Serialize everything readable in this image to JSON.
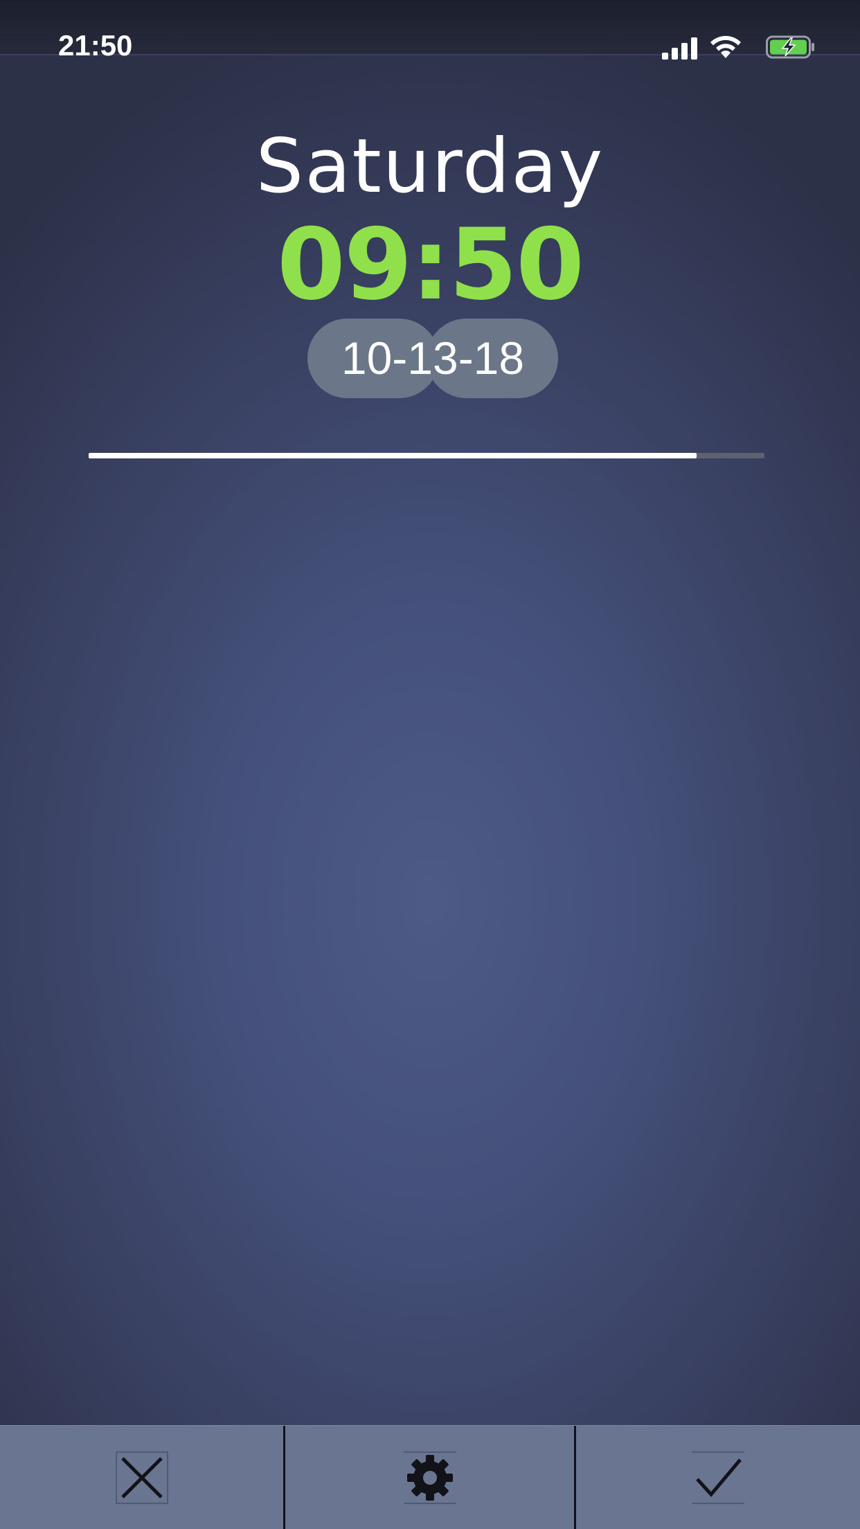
{
  "status_bar": {
    "time": "21:50",
    "icons": [
      "cellular-signal-icon",
      "wifi-icon",
      "battery-charging-icon"
    ]
  },
  "alarm": {
    "day": "Saturday",
    "time": "09:50",
    "date": "10-13-18",
    "progress": 0.9
  },
  "toolbar": {
    "buttons": [
      {
        "icon": "close-icon"
      },
      {
        "icon": "gear-icon"
      },
      {
        "icon": "checkmark-icon"
      }
    ]
  },
  "colors": {
    "time_accent": "#8fe04a",
    "date_pill": "#6b7689",
    "toolbar_bg": "#6a7592",
    "battery_fill": "#62d04e"
  }
}
